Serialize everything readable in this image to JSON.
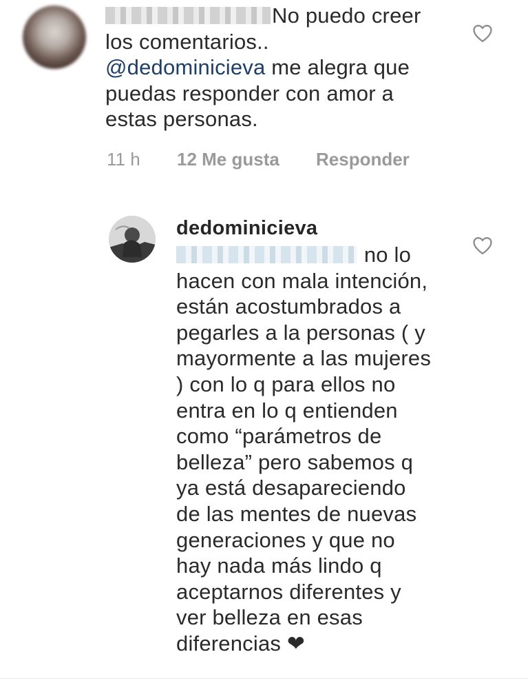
{
  "comment": {
    "text_line1": "No puedo creer",
    "text_line2": "los comentarios..",
    "mention": "@dedominicieva",
    "text_after_mention": " me alegra que",
    "text_line4": "puedas responder con amor a",
    "text_line5": "estas personas.",
    "time": "11 h",
    "likes": "12 Me gusta",
    "reply_label": "Responder"
  },
  "reply": {
    "username": "dedominicieva",
    "lines": [
      "no lo",
      "hacen con mala intención,",
      "están acostumbrados a",
      "pegarles a la personas ( y",
      "mayormente a las mujeres",
      ") con lo q para ellos no",
      "entra en lo q entienden",
      "como “parámetros de",
      "belleza” pero sabemos q",
      "ya está desapareciendo",
      "de las mentes de nuevas",
      "generaciones y que no",
      "hay nada más lindo q",
      "aceptarnos diferentes y",
      "ver belleza en esas",
      "diferencias ❤"
    ]
  },
  "icons": {
    "like": "heart-outline-icon",
    "avatar": "user-avatar"
  },
  "colors": {
    "text": "#262626",
    "mention": "#1f3f6b",
    "meta": "#9a9a9a"
  }
}
